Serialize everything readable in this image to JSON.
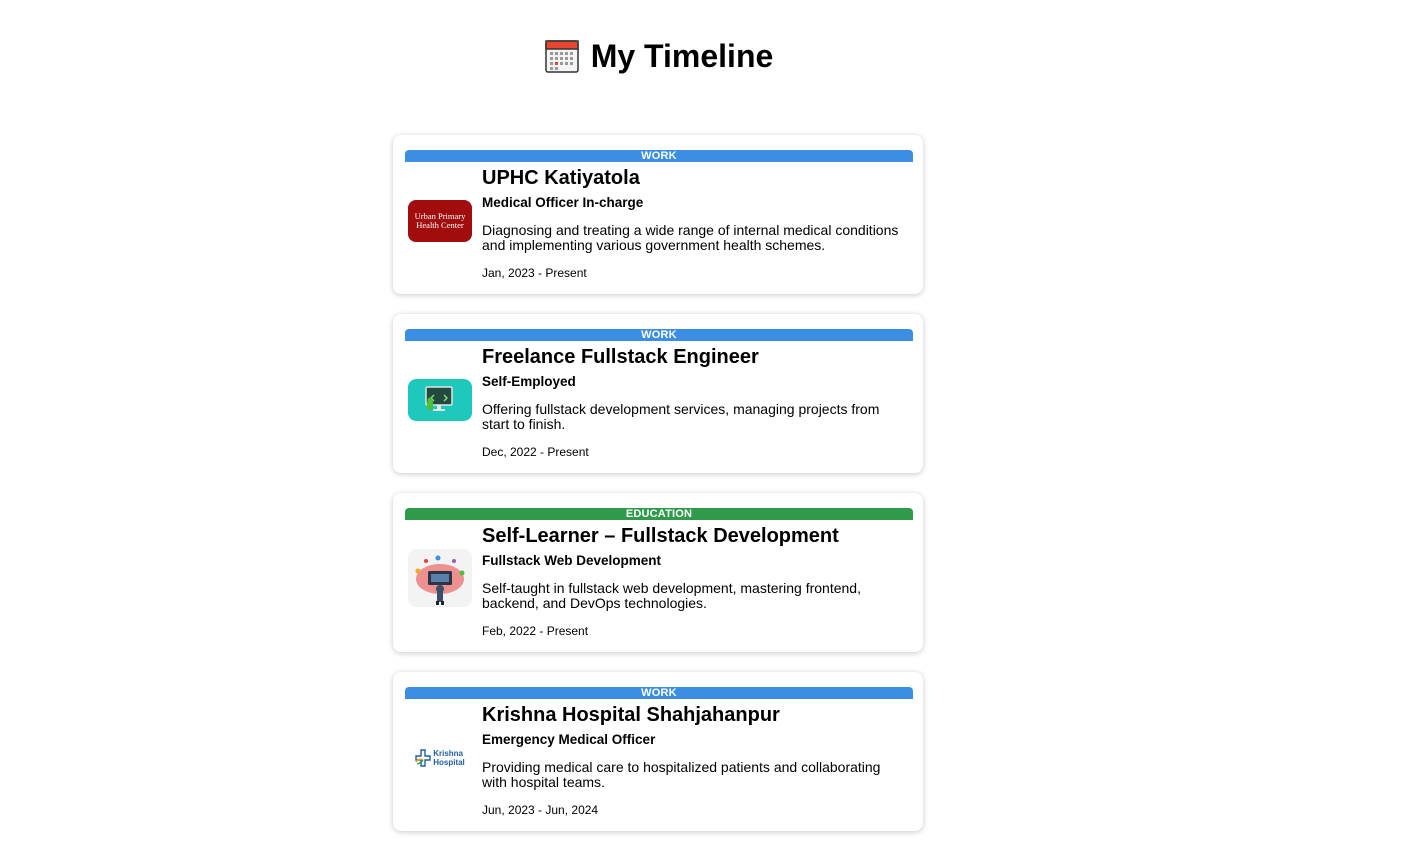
{
  "header": {
    "icon": "calendar-icon",
    "title": "My Timeline"
  },
  "entries": [
    {
      "tag": "WORK",
      "tag_color": "#3b8ee2",
      "title": "UPHC Katiyatola",
      "role": "Medical Officer In-charge",
      "description": "Diagnosing and treating a wide range of internal medical conditions and implementing various government health schemes.",
      "dates": "Jan, 2023 - Present",
      "logo_text_line1": "Urban Primary",
      "logo_text_line2": "Health Center"
    },
    {
      "tag": "WORK",
      "tag_color": "#3b8ee2",
      "title": "Freelance Fullstack Engineer",
      "role": "Self-Employed",
      "description": "Offering fullstack development services, managing projects from start to finish.",
      "dates": "Dec, 2022 - Present"
    },
    {
      "tag": "EDUCATION",
      "tag_color": "#2e9a4a",
      "title": "Self-Learner – Fullstack Development",
      "role": "Fullstack Web Development",
      "description": "Self-taught in fullstack web development, mastering frontend, backend, and DevOps technologies.",
      "dates": "Feb, 2022 - Present"
    },
    {
      "tag": "WORK",
      "tag_color": "#3b8ee2",
      "title": "Krishna Hospital Shahjahanpur",
      "role": "Emergency Medical Officer",
      "description": "Providing medical care to hospitalized patients and collaborating with hospital teams.",
      "dates": "Jun, 2023 - Jun, 2024",
      "logo_text_line1": "Krishna",
      "logo_text_line2": "Hospital"
    }
  ]
}
